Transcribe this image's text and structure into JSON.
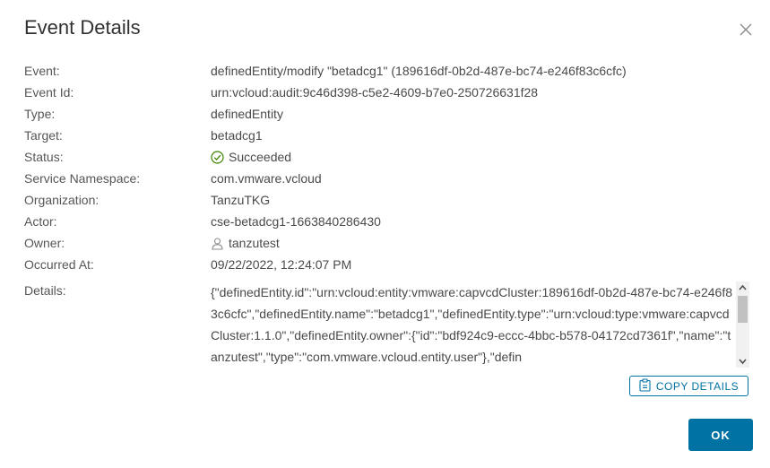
{
  "dialog": {
    "title": "Event Details",
    "ok_label": "OK",
    "copy_label": "COPY DETAILS"
  },
  "fields": {
    "event_label": "Event:",
    "event_value": "definedEntity/modify \"betadcg1\" (189616df-0b2d-487e-bc74-e246f83c6cfc)",
    "event_id_label": "Event Id:",
    "event_id_value": "urn:vcloud:audit:9c46d398-c5e2-4609-b7e0-250726631f28",
    "type_label": "Type:",
    "type_value": "definedEntity",
    "target_label": "Target:",
    "target_value": "betadcg1",
    "status_label": "Status:",
    "status_value": "Succeeded",
    "service_namespace_label": "Service Namespace:",
    "service_namespace_value": "com.vmware.vcloud",
    "organization_label": "Organization:",
    "organization_value": "TanzuTKG",
    "actor_label": "Actor:",
    "actor_value": "cse-betadcg1-1663840286430",
    "owner_label": "Owner:",
    "owner_value": "tanzutest",
    "occurred_at_label": "Occurred At:",
    "occurred_at_value": "09/22/2022, 12:24:07 PM",
    "details_label": "Details:",
    "details_value": "{\"definedEntity.id\":\"urn:vcloud:entity:vmware:capvcdCluster:189616df-0b2d-487e-bc74-e246f83c6cfc\",\"definedEntity.name\":\"betadcg1\",\"definedEntity.type\":\"urn:vcloud:type:vmware:capvcdCluster:1.1.0\",\"definedEntity.owner\":{\"id\":\"bdf924c9-eccc-4bbc-b578-04172cd7361f\",\"name\":\"tanzutest\",\"type\":\"com.vmware.vcloud.entity.user\"},\"defin"
  },
  "colors": {
    "accent": "#0072a3",
    "success": "#3c8500"
  },
  "icons": {
    "close": "close-icon",
    "status": "success-circle-icon",
    "owner": "user-icon",
    "copy": "clipboard-icon"
  }
}
